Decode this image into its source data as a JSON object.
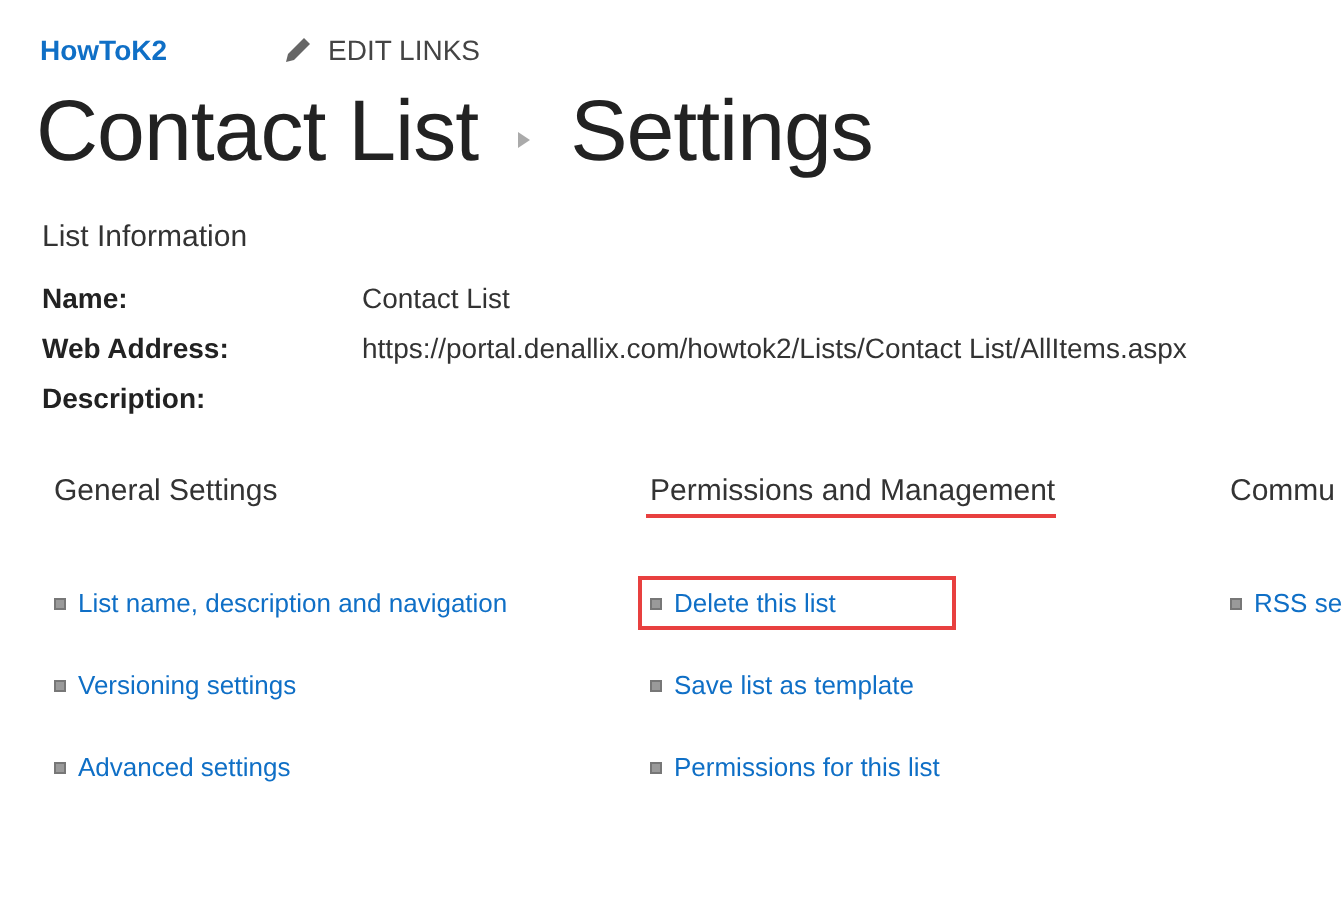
{
  "header": {
    "site_title": "HowToK2",
    "edit_links": "EDIT LINKS"
  },
  "breadcrumb": [
    "Contact List",
    "Settings"
  ],
  "list_information": {
    "title": "List Information",
    "fields": [
      {
        "label": "Name:",
        "value": "Contact List"
      },
      {
        "label": "Web Address:",
        "value": "https://portal.denallix.com/howtok2/Lists/Contact List/AllItems.aspx"
      },
      {
        "label": "Description:"
      }
    ]
  },
  "sections": [
    {
      "heading": "General Settings",
      "highlighted": false,
      "links": [
        {
          "label": "List name, description and navigation",
          "highlighted": false
        },
        {
          "label": "Versioning settings",
          "highlighted": false
        },
        {
          "label": "Advanced settings",
          "highlighted": false
        }
      ]
    },
    {
      "heading": "Permissions and Management",
      "highlighted": true,
      "links": [
        {
          "label": "Delete this list",
          "highlighted": true
        },
        {
          "label": "Save list as template",
          "highlighted": false
        },
        {
          "label": "Permissions for this list",
          "highlighted": false
        }
      ]
    },
    {
      "heading": "Commu",
      "highlighted": false,
      "links": [
        {
          "label": "RSS se",
          "highlighted": false
        }
      ]
    }
  ]
}
